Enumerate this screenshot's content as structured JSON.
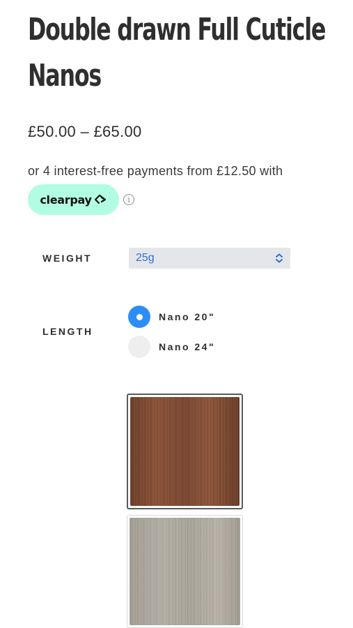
{
  "product": {
    "title": "Double drawn Full Cuticle Nanos",
    "price_range": "£50.00 – £65.00"
  },
  "clearpay": {
    "installments_text": "or 4 interest-free payments from £12.50 with",
    "badge_label": "clearpay",
    "badge_color": "#b2fce4",
    "logo_icon": "clearpay-arrows-icon",
    "info_icon": "info-icon",
    "info_glyph": "i"
  },
  "options": {
    "weight": {
      "label": "WEIGHT",
      "selected_value": "25g",
      "icon": "chevron-up-down-icon"
    },
    "length": {
      "label": "LENGTH",
      "choices": [
        {
          "label": "Nano 20\"",
          "selected": true
        },
        {
          "label": "Nano 24\"",
          "selected": false
        }
      ]
    }
  },
  "colors": {
    "accent": "#2c8ef5",
    "select_text": "#2f6fd1",
    "swatches": [
      {
        "name": "brown-hair-swatch",
        "selected": true
      },
      {
        "name": "grey-blonde-hair-swatch",
        "selected": false
      }
    ]
  }
}
